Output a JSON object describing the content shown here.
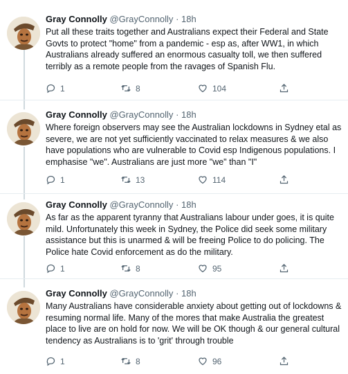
{
  "tweets": [
    {
      "name": "Gray Connolly",
      "handle": "@GrayConnolly",
      "separator": "·",
      "time": "18h",
      "text": "Put all these traits together and Australians expect their Federal and State Govts to protect \"home\" from a pandemic - esp as, after WW1, in which Australians already suffered an enormous casualty toll, we then suffered terribly as a remote people from the ravages of Spanish Flu.",
      "replies": "1",
      "retweets": "8",
      "likes": "104"
    },
    {
      "name": "Gray Connolly",
      "handle": "@GrayConnolly",
      "separator": "·",
      "time": "18h",
      "text": "Where foreign observers may see the Australian lockdowns in Sydney etal as severe, we are not yet sufficiently vaccinated to relax measures & we also have populations who are vulnerable to Covid esp Indigenous populations. I emphasise \"we\". Australians are just more \"we\" than \"I\"",
      "replies": "1",
      "retweets": "13",
      "likes": "114"
    },
    {
      "name": "Gray Connolly",
      "handle": "@GrayConnolly",
      "separator": "·",
      "time": "18h",
      "text": "As far as the apparent tyranny that Australians labour under goes, it is quite mild.  Unfortunately this week in Sydney, the Police did seek some military assistance but this is unarmed & will be freeing Police to do policing. The Police hate Covid enforcement as do the military.",
      "replies": "1",
      "retweets": "8",
      "likes": "95"
    },
    {
      "name": "Gray Connolly",
      "handle": "@GrayConnolly",
      "separator": "·",
      "time": "18h",
      "text": "Many Australians have considerable anxiety about getting out of lockdowns & resuming normal life. Many of the mores that make Australia the greatest place to live are on hold for now. We will be OK though & our general cultural tendency as Australians is to 'grit' through trouble",
      "replies": "1",
      "retweets": "8",
      "likes": "96"
    }
  ],
  "icons": {
    "reply": "reply-icon",
    "retweet": "retweet-icon",
    "like": "heart-icon",
    "share": "share-icon"
  },
  "colors": {
    "text": "#0f1419",
    "secondary": "#536471",
    "thread_line": "#cfd9de"
  }
}
